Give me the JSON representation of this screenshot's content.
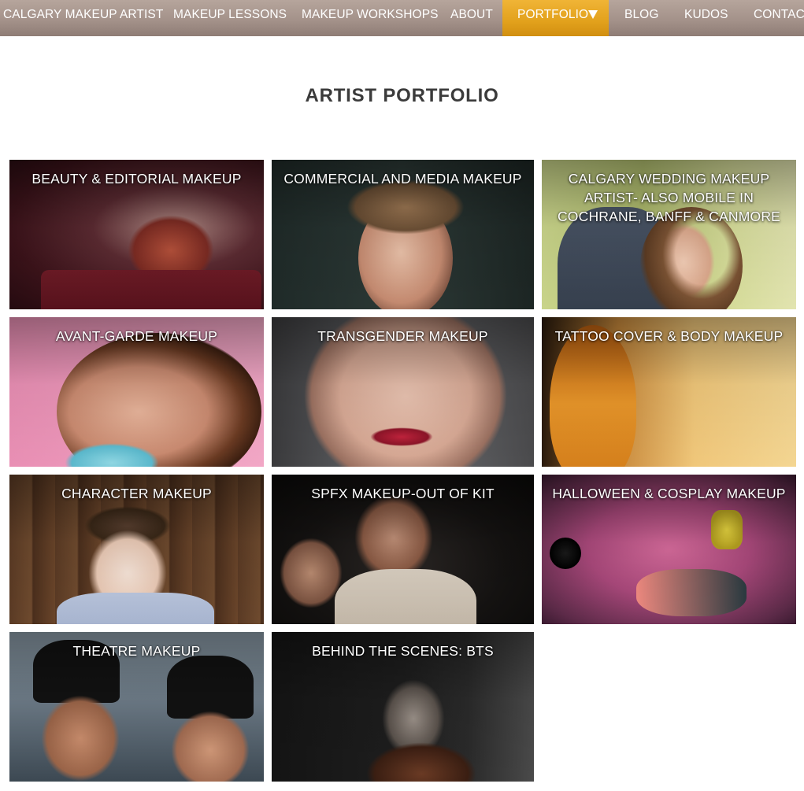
{
  "nav": {
    "items": [
      {
        "label": "CALGARY MAKEUP ARTIST"
      },
      {
        "label": "MAKEUP LESSONS"
      },
      {
        "label": "MAKEUP WORKSHOPS"
      },
      {
        "label": "ABOUT"
      },
      {
        "label": "PORTFOLIO",
        "active": true,
        "icon": "dropdown-triangle-icon"
      },
      {
        "label": "BLOG"
      },
      {
        "label": "KUDOS"
      },
      {
        "label": "CONTACT"
      }
    ],
    "bar_color": "#a4928a",
    "active_color": "#e2a11c"
  },
  "page": {
    "title": "ARTIST PORTFOLIO"
  },
  "portfolio": {
    "tiles": [
      {
        "label": "BEAUTY & EDITORIAL MAKEUP"
      },
      {
        "label": "COMMERCIAL AND MEDIA MAKEUP"
      },
      {
        "label": "CALGARY WEDDING MAKEUP ARTIST- ALSO MOBILE IN COCHRANE, BANFF & CANMORE"
      },
      {
        "label": "AVANT-GARDE MAKEUP"
      },
      {
        "label": "TRANSGENDER MAKEUP"
      },
      {
        "label": "TATTOO COVER & BODY MAKEUP"
      },
      {
        "label": "CHARACTER MAKEUP"
      },
      {
        "label": "SPFX MAKEUP-OUT OF KIT"
      },
      {
        "label": "HALLOWEEN & COSPLAY MAKEUP"
      },
      {
        "label": "THEATRE MAKEUP"
      },
      {
        "label": "BEHIND THE SCENES: BTS"
      }
    ]
  }
}
